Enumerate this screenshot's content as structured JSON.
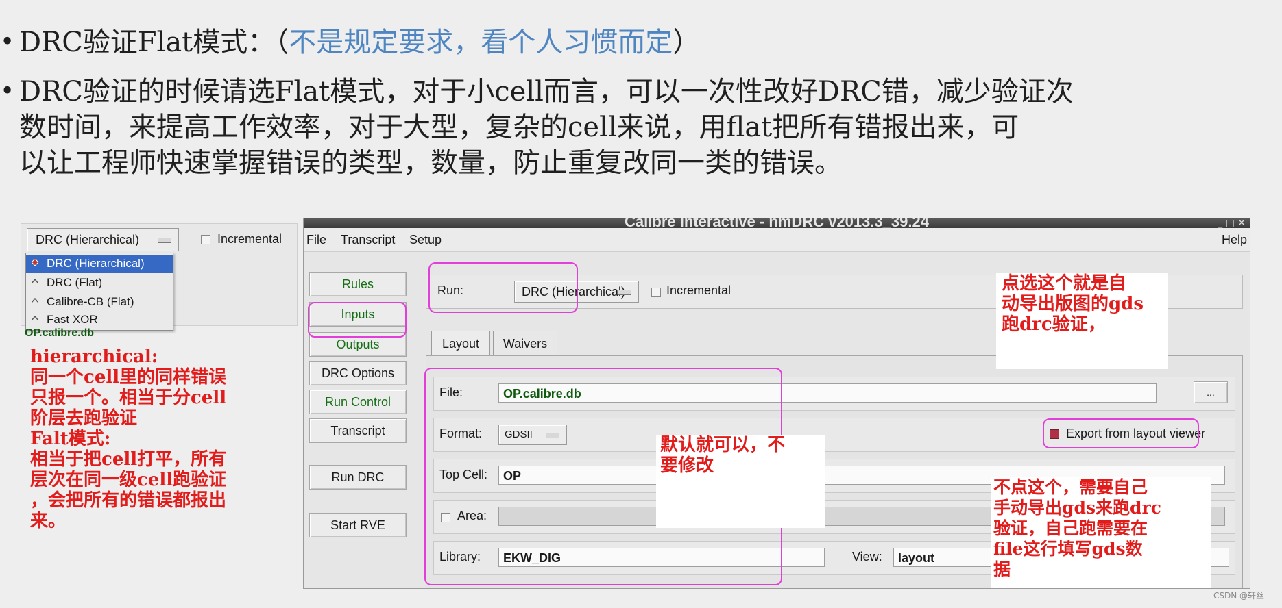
{
  "slide": {
    "bullet_marker": "•",
    "bullet1_main": "DRC验证Flat模式：（",
    "bullet1_blue": "不是规定要求，看个人习惯而定",
    "bullet1_end": "）",
    "bullet2_lines": [
      "DRC验证的时候请选Flat模式，对于小cell而言，可以一次性改好DRC错，减少验证次",
      "数时间，来提高工作效率，对于大型，复杂的cell来说，用flat把所有错报出来，可",
      "以让工程师快速掌握错误的类型，数量，防止重复改同一类的错误。"
    ]
  },
  "left_popup": {
    "combo_value": "DRC (Hierarchical)",
    "incremental_label": "Incremental",
    "menu_items": [
      "DRC (Hierarchical)",
      "DRC (Flat)",
      "Calibre-CB (Flat)",
      "Fast XOR"
    ],
    "selected_index": 0,
    "file_value": "OP.calibre.db"
  },
  "left_note_lines": [
    "hierarchical:",
    "同一个cell里的同样错误",
    "只报一个。相当于分cell",
    "阶层去跑验证",
    "Falt模式:",
    "相当于把cell打平，所有",
    "层次在同一级cell跑验证",
    "，会把所有的错误都报出",
    "来。"
  ],
  "window": {
    "title": "Calibre Interactive - nmDRC v2013.3_39.24",
    "controls": "_ □ ✕",
    "menu": [
      "File",
      "Transcript",
      "Setup"
    ],
    "help": "Help",
    "sidebar": [
      "Rules",
      "Inputs",
      "Outputs",
      "DRC Options",
      "Run Control",
      "Transcript",
      "Run DRC",
      "Start RVE"
    ],
    "run_label": "Run:",
    "run_value": "DRC (Hierarchical)",
    "incremental_label": "Incremental",
    "tabs": [
      "Layout",
      "Waivers"
    ],
    "file_label": "File:",
    "file_value": "OP.calibre.db",
    "browse_label": "...",
    "format_label": "Format:",
    "format_value": "GDSII",
    "export_label": "Export from layout viewer",
    "topcell_label": "Top Cell:",
    "topcell_value": "OP",
    "area_label": "Area:",
    "library_label": "Library:",
    "library_value": "EKW_DIG",
    "view_label": "View:",
    "view_value": "layout"
  },
  "notes": {
    "export_note": [
      "点选这个就是自",
      "动导出版图的gds",
      "跑drc验证，"
    ],
    "default_note": [
      "默认就可以，不",
      "要修改"
    ],
    "manual_note": [
      "不点这个，需要自己",
      "手动导出gds来跑drc",
      "验证，自己跑需要在",
      "file这行填写gds数",
      "据"
    ]
  },
  "watermark": "CSDN @轩丝",
  "colors": {
    "annotation_red": "#e21b1b",
    "highlight_magenta": "#e23fd8",
    "selection_blue": "#3569c4",
    "accent_blue": "#4f86c2"
  }
}
